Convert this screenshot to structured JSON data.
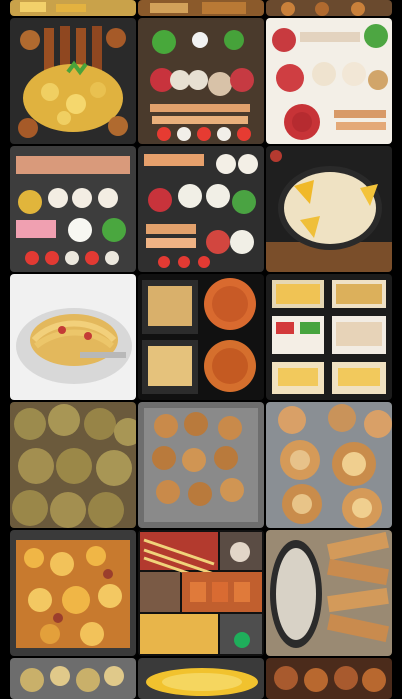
{
  "gallery": {
    "columns": 3,
    "tiles": [
      {
        "name": "partial-top-left"
      },
      {
        "name": "partial-top-middle"
      },
      {
        "name": "partial-top-right"
      },
      {
        "name": "sausages-potatoes"
      },
      {
        "name": "party-platter-1"
      },
      {
        "name": "party-platter-2"
      },
      {
        "name": "party-platter-3"
      },
      {
        "name": "party-platter-4"
      },
      {
        "name": "cheese-fondue-plate"
      },
      {
        "name": "spaghetti-plate"
      },
      {
        "name": "takeaway-boxes-grid"
      },
      {
        "name": "lunch-trays"
      },
      {
        "name": "meat-patties"
      },
      {
        "name": "fried-chicken-tray"
      },
      {
        "name": "cheese-rolls"
      },
      {
        "name": "lasagna-tray"
      },
      {
        "name": "collage-mix"
      },
      {
        "name": "dip-and-flatbread"
      },
      {
        "name": "partial-bottom-left"
      },
      {
        "name": "partial-bottom-middle"
      },
      {
        "name": "partial-bottom-right"
      }
    ]
  },
  "colors": {
    "background": "#000000",
    "badge": "#1fae5b"
  }
}
